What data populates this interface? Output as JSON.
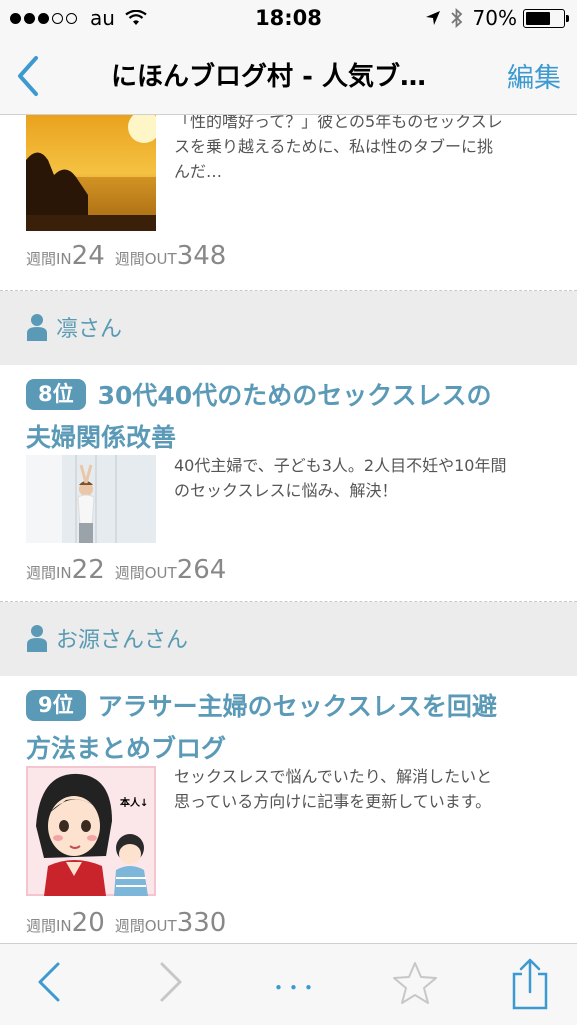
{
  "status_bar": {
    "carrier": "au",
    "time": "18:08",
    "battery": "70%",
    "battery_level": 0.7
  },
  "nav": {
    "title": "にほんブログ村 - 人気ブ…",
    "edit_label": "編集"
  },
  "entries": [
    {
      "description_lines": [
        "「性的嗜好って？」彼との5年ものセックスレ",
        "スを乗り越えるために、私は性のタブーに挑",
        "んだ…"
      ],
      "in_label": "週間IN",
      "in_value": "24",
      "out_label": "週間OUT",
      "out_value": "348"
    },
    {
      "user": "凛さん",
      "rank": "8位",
      "title_lines": [
        "30代40代のためのセックスレスの",
        "夫婦関係改善"
      ],
      "description_lines": [
        "40代主婦で、子ども3人。2人目不妊や10年間",
        "のセックスレスに悩み、解決！"
      ],
      "in_label": "週間IN",
      "in_value": "22",
      "out_label": "週間OUT",
      "out_value": "264"
    },
    {
      "user": "お源さんさん",
      "rank": "9位",
      "title_lines": [
        "アラサー主婦のセックスレスを回避",
        "方法まとめブログ"
      ],
      "thumb_caption": "本人↓",
      "description_lines": [
        "セックスレスで悩んでいたり、解消したいと",
        "思っている方向けに記事を更新しています。"
      ],
      "in_label": "週間IN",
      "in_value": "20",
      "out_label": "週間OUT",
      "out_value": "330"
    }
  ],
  "toolbar": {
    "more_label": "･･･"
  },
  "colors": {
    "accent": "#3d9ad1",
    "title_blue": "#5b9ab7",
    "user_bg": "#ececec"
  }
}
